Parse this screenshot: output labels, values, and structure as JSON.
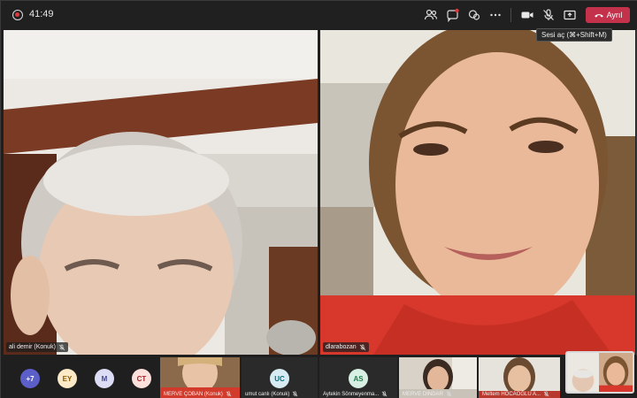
{
  "topbar": {
    "timer": "41:49",
    "leave_label": "Ayrıl"
  },
  "tooltip": {
    "text": "Sesi aç (⌘+Shift+M)"
  },
  "tiles": [
    {
      "name": "ali demir (Konuk)"
    },
    {
      "name": "dlarabozan"
    }
  ],
  "overflow_avatars": [
    {
      "initials": "+7",
      "bg": "#5b5fc7",
      "fg": "#ffffff"
    },
    {
      "initials": "EY",
      "bg": "#fbe9c7",
      "fg": "#8a5a00"
    },
    {
      "initials": "M",
      "bg": "#dcdcf5",
      "fg": "#444791"
    },
    {
      "initials": "CT",
      "bg": "#fbe0dc",
      "fg": "#a4262c"
    }
  ],
  "thumbs": [
    {
      "name": "MERVE ÇOBAN (Konuk)",
      "type": "video"
    },
    {
      "name": "umut canlı (Konuk)",
      "initials": "UC",
      "bg": "#d6ecf2",
      "fg": "#0b6a84",
      "type": "avatar"
    },
    {
      "name": "Aytekin Sönmeyenma...",
      "initials": "AS",
      "bg": "#d8efe3",
      "fg": "#237b4b",
      "type": "avatar"
    },
    {
      "name": "MERVE DİNDAR",
      "type": "video"
    },
    {
      "name": "Meltem HOCAOĞLU A...",
      "type": "video"
    }
  ],
  "colors": {
    "background": "#1f1f1f",
    "leave": "#c4314b",
    "accent": "#5b5fc7"
  },
  "icons": [
    "record-icon",
    "participants-icon",
    "chat-icon",
    "reactions-icon",
    "more-icon",
    "camera-icon",
    "mic-off-icon",
    "share-icon",
    "phone-hangup-icon",
    "mic-muted-icon"
  ]
}
